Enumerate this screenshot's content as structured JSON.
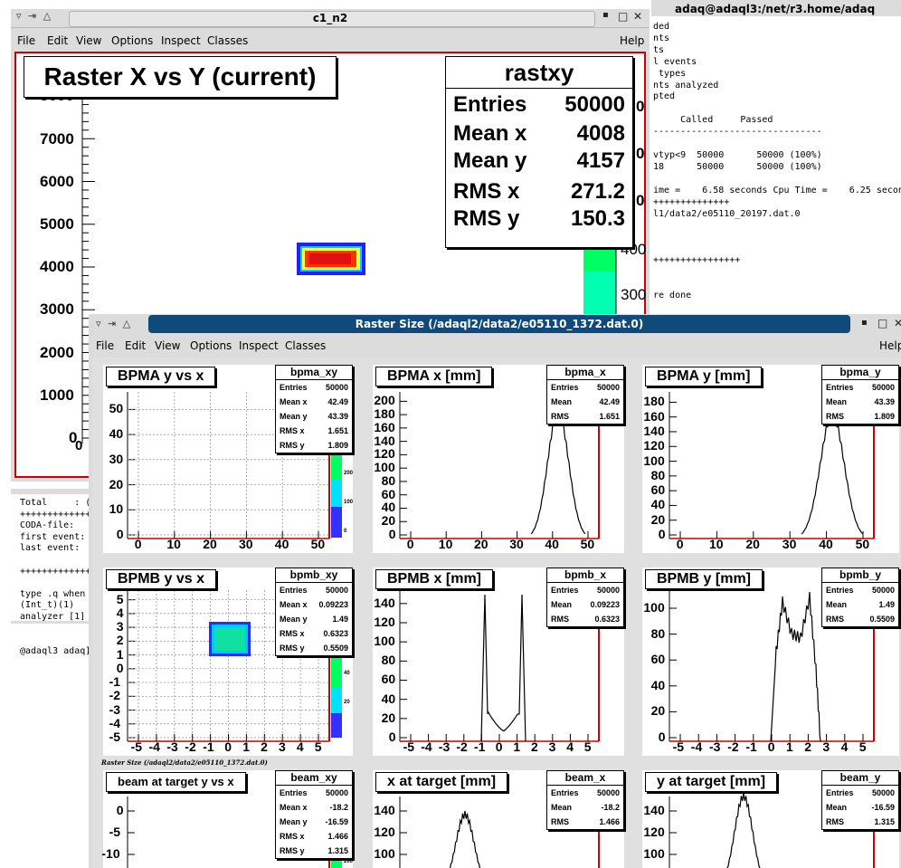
{
  "terminal": {
    "title": "adaq@adaql3:/net/r3.home/adaq",
    "lines": [
      "ded",
      "nts",
      "ts",
      "l events",
      " types",
      "nts analyzed",
      "pted",
      "",
      "     Called     Passed",
      "-------------------------------",
      "",
      "vtyp<9  50000      50000 (100%)",
      "18      50000      50000 (100%)",
      "",
      "ime =    6.58 seconds Cpu Time =    6.25 seconds",
      "++++++++++++++",
      "l1/data2/e05110_20197.dat.0",
      "",
      "",
      "",
      "++++++++++++++++",
      "",
      "",
      "re done"
    ],
    "left_lines": [
      "Total     : (",
      "+++++++++++++",
      "CODA-file:",
      "first event:",
      "last event:",
      "",
      "+++++++++++++",
      "",
      "type .q when",
      "(Int_t)(1)",
      "analyzer [1]",
      "",
      "",
      "@adaql3 adaq]$"
    ]
  },
  "window1": {
    "title": "c1_n2",
    "menu": [
      "File",
      "Edit",
      "View",
      "Options",
      "Inspect",
      "Classes"
    ],
    "help": "Help",
    "plot_title": "Raster X vs Y (current)",
    "yticks": [
      "8000",
      "7000",
      "6000",
      "5000",
      "4000",
      "3000",
      "2000",
      "1000",
      "0"
    ],
    "xtick0": "0",
    "z_ticks": [
      "400",
      "300"
    ],
    "stats": {
      "name": "rastxy",
      "rows": [
        {
          "k": "Entries",
          "v": "50000"
        },
        {
          "k": "Mean x",
          "v": "4008"
        },
        {
          "k": "Mean y",
          "v": "4157"
        },
        {
          "k": "RMS x",
          "v": "271.2"
        },
        {
          "k": "RMS y",
          "v": "150.3"
        }
      ]
    }
  },
  "window2": {
    "title": "Raster Size (/adaql2/data2/e05110_1372.dat.0)",
    "menu": [
      "File",
      "Edit",
      "View",
      "Options",
      "Inspect",
      "Classes"
    ],
    "help": "Help",
    "caption": "Raster Size (/adaql2/data2/e05110_1372.dat.0)"
  },
  "pads": [
    {
      "title": "BPMA y vs x",
      "stat_name": "bpma_xy",
      "stats": [
        {
          "k": "Entries",
          "v": "50000"
        },
        {
          "k": "Mean x",
          "v": "42.49"
        },
        {
          "k": "Mean y",
          "v": "43.39"
        },
        {
          "k": "RMS x",
          "v": "1.651"
        },
        {
          "k": "RMS y",
          "v": "1.809"
        }
      ],
      "yticks": [
        "50",
        "40",
        "30",
        "20",
        "10",
        "0"
      ],
      "xticks": [
        "0",
        "10",
        "20",
        "30",
        "40",
        "50"
      ],
      "z_ticks": [
        "200",
        "100",
        "0"
      ]
    },
    {
      "title": "BPMA x [mm]",
      "stat_name": "bpma_x",
      "stats": [
        {
          "k": "Entries",
          "v": "50000"
        },
        {
          "k": "Mean",
          "v": "42.49"
        },
        {
          "k": "RMS",
          "v": "1.651"
        }
      ],
      "yticks": [
        "200",
        "180",
        "160",
        "140",
        "120",
        "100",
        "80",
        "60",
        "40",
        "20",
        "0"
      ],
      "xticks": [
        "0",
        "10",
        "20",
        "30",
        "40",
        "50"
      ]
    },
    {
      "title": "BPMA y [mm]",
      "stat_name": "bpma_y",
      "stats": [
        {
          "k": "Entries",
          "v": "50000"
        },
        {
          "k": "Mean",
          "v": "43.39"
        },
        {
          "k": "RMS",
          "v": "1.809"
        }
      ],
      "yticks": [
        "180",
        "160",
        "140",
        "120",
        "100",
        "80",
        "60",
        "40",
        "20",
        "0"
      ],
      "xticks": [
        "0",
        "10",
        "20",
        "30",
        "40",
        "50"
      ]
    },
    {
      "title": "BPMB y vs x",
      "stat_name": "bpmb_xy",
      "stats": [
        {
          "k": "Entries",
          "v": "50000"
        },
        {
          "k": "Mean x",
          "v": "0.09223"
        },
        {
          "k": "Mean y",
          "v": "1.49"
        },
        {
          "k": "RMS x",
          "v": "0.6323"
        },
        {
          "k": "RMS y",
          "v": "0.5509"
        }
      ],
      "yticks": [
        "5",
        "4",
        "3",
        "2",
        "1",
        "0",
        "-1",
        "-2",
        "-3",
        "-4",
        "-5"
      ],
      "xticks": [
        "-5",
        "-4",
        "-3",
        "-2",
        "-1",
        "0",
        "1",
        "2",
        "3",
        "4",
        "5"
      ],
      "z_ticks": [
        "40",
        "20"
      ]
    },
    {
      "title": "BPMB x [mm]",
      "stat_name": "bpmb_x",
      "stats": [
        {
          "k": "Entries",
          "v": "50000"
        },
        {
          "k": "Mean",
          "v": "0.09223"
        },
        {
          "k": "RMS",
          "v": "0.6323"
        }
      ],
      "yticks": [
        "140",
        "120",
        "100",
        "80",
        "60",
        "40",
        "20",
        "0"
      ],
      "xticks": [
        "-5",
        "-4",
        "-3",
        "-2",
        "-1",
        "0",
        "1",
        "2",
        "3",
        "4",
        "5"
      ]
    },
    {
      "title": "BPMB y [mm]",
      "stat_name": "bpmb_y",
      "stats": [
        {
          "k": "Entries",
          "v": "50000"
        },
        {
          "k": "Mean",
          "v": "1.49"
        },
        {
          "k": "RMS",
          "v": "0.5509"
        }
      ],
      "yticks": [
        "100",
        "80",
        "60",
        "40",
        "20",
        "0"
      ],
      "xticks": [
        "-5",
        "-4",
        "-3",
        "-2",
        "-1",
        "0",
        "1",
        "2",
        "3",
        "4",
        "5"
      ]
    },
    {
      "title": "beam at target y vs x",
      "stat_name": "beam_xy",
      "stats": [
        {
          "k": "Entries",
          "v": "50000"
        },
        {
          "k": "Mean x",
          "v": "-18.2"
        },
        {
          "k": "Mean y",
          "v": "-16.59"
        },
        {
          "k": "RMS x",
          "v": "1.466"
        },
        {
          "k": "RMS y",
          "v": "1.315"
        }
      ],
      "yticks": [
        "0",
        "-5",
        "-10"
      ],
      "xticks": [],
      "z_ticks": [
        "200"
      ]
    },
    {
      "title": "x at target [mm]",
      "stat_name": "beam_x",
      "stats": [
        {
          "k": "Entries",
          "v": "50000"
        },
        {
          "k": "Mean",
          "v": "-18.2"
        },
        {
          "k": "RMS",
          "v": "1.466"
        }
      ],
      "yticks": [
        "140",
        "120",
        "100",
        "80"
      ],
      "xticks": []
    },
    {
      "title": "y at target [mm]",
      "stat_name": "beam_y",
      "stats": [
        {
          "k": "Entries",
          "v": "50000"
        },
        {
          "k": "Mean",
          "v": "-16.59"
        },
        {
          "k": "RMS",
          "v": "1.315"
        }
      ],
      "yticks": [
        "140",
        "120",
        "100",
        "80"
      ],
      "xticks": []
    }
  ]
}
